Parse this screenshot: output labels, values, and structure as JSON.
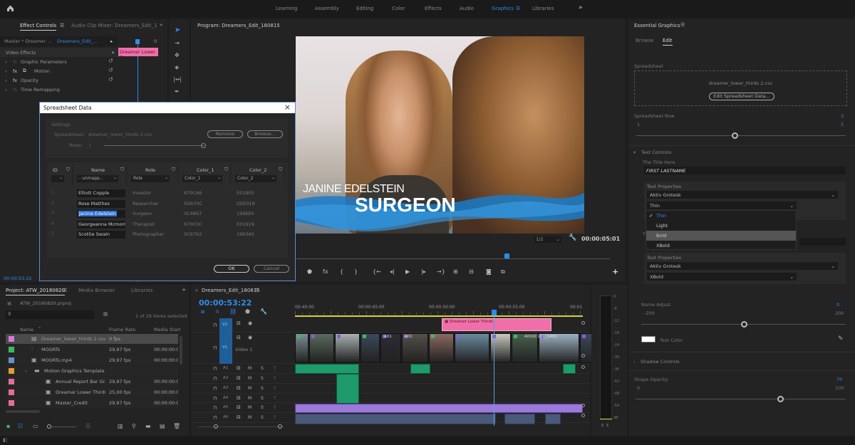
{
  "topbar": {
    "home_icon": "home-icon",
    "workspaces": [
      "Learning",
      "Assembly",
      "Editing",
      "Color",
      "Effects",
      "Audio",
      "Graphics",
      "Libraries"
    ],
    "active": "Graphics",
    "more": "»"
  },
  "effect_controls": {
    "tabs": [
      "Effect Controls",
      "Audio Clip Mixer: Dreamers_Edit_1"
    ],
    "master": "Master * Dreamer ...",
    "sequence": "Dreamers_Edit_...",
    "time_zero": "0",
    "clip_label": "Dreamer Lower T",
    "section": "Video Effects",
    "effects": [
      "Graphic Parameters",
      "Motion",
      "Opacity",
      "Time Remapping"
    ],
    "timecode": "00:00:53:22"
  },
  "dialog": {
    "title": "Spreadsheet Data",
    "close": "×",
    "settings_label": "Settings",
    "spreadsheet_label": "Spreadsheet:",
    "spreadsheet_file": "dreamer_lower_thirds 2.csv",
    "remove": "Remove",
    "browse": "Browse...",
    "rows_label": "Rows:",
    "rows_value": "1",
    "columns": [
      {
        "header": "ID",
        "mapping": ""
      },
      {
        "header": "Name",
        "mapping": "- unmapp..."
      },
      {
        "header": "Role",
        "mapping": "Role"
      },
      {
        "header": "Color_1",
        "mapping": "Color_1"
      },
      {
        "header": "Color_2",
        "mapping": "Color_2"
      }
    ],
    "rows": [
      {
        "id": "1",
        "name": "Elliott Copple",
        "role": "Investor",
        "c1": "670C66",
        "c2": "E019E0"
      },
      {
        "id": "2",
        "name": "Rose Matthes",
        "role": "Researcher",
        "c1": "5D670C",
        "c2": "DEE019"
      },
      {
        "id": "3",
        "name": "Janine Edelstein",
        "role": "Surgeon",
        "c1": "0C4867",
        "c2": "199EE0"
      },
      {
        "id": "4",
        "name": "Georgeanna Mcmorr",
        "role": "Therapist",
        "c1": "670C0C",
        "c2": "E01919"
      },
      {
        "id": "5",
        "name": "Scottie Swain",
        "role": "Photographer",
        "c1": "0C6762",
        "c2": "19E0A5"
      }
    ],
    "ok": "OK",
    "cancel": "Cancel"
  },
  "program": {
    "title": "Program: Dreamers_Edit_180815",
    "lower_third_name": "JANINE EDELSTEIN",
    "lower_third_role": "SURGEON",
    "resolution": "1/2",
    "timecode": "00:00:05:01",
    "controls": [
      "marker-icon",
      "fx-icon",
      "mark-in-icon",
      "mark-out-icon",
      "go-to-in-icon",
      "step-back-icon",
      "play-icon",
      "step-forward-icon",
      "go-to-out-icon",
      "insert-icon",
      "overwrite-icon",
      "camera-icon",
      "compare-icon"
    ],
    "add": "+"
  },
  "essential_graphics": {
    "title": "Essential Graphics",
    "tabs": [
      "Browse",
      "Edit"
    ],
    "active_tab": "Edit",
    "spreadsheet_label": "Spreadsheet",
    "spreadsheet_file": "dreamer_lower_thirds 2.csv",
    "edit_button": "Edit Spreadsheet Data...",
    "row_label": "Spreadsheet Row",
    "row_value": "3",
    "row_min": "1",
    "row_max": "5",
    "row_position": 0.5,
    "text_controls": "Text Controls",
    "title_label": "The Title Here",
    "title_value": "FIRST LASTNAME",
    "text_properties": "Text Properties",
    "font": "Aktiv Grotesk",
    "weight": "Thin",
    "weight_options": [
      "Thin",
      "Light",
      "Bold",
      "XBold"
    ],
    "weight_checked": "Thin",
    "weight_hover": "Bold",
    "text_properties_2": "Text Properties",
    "font_2": "Aktiv Grotesk",
    "weight_2": "XBold",
    "name_adjust_label": "Name Adjust",
    "name_adjust_value": "0",
    "name_adjust_min": "-200",
    "name_adjust_max": "200",
    "name_adjust_position": 0.5,
    "text_color_label": "Text Color",
    "text_color": "#ffffff",
    "shadow_controls": "Shadow Controls",
    "shape_opacity_label": "Shape Opacity",
    "shape_opacity_value": "70",
    "shape_opacity_min": "0",
    "shape_opacity_max": "100"
  },
  "project": {
    "tabs": [
      "Project: ATW_20180820",
      "Media Browser",
      "Libraries"
    ],
    "file": "ATW_20180820.prproj",
    "count": "1 of 29 items selected",
    "columns": [
      "Name",
      "Frame Rate",
      "Media Start"
    ],
    "items": [
      {
        "name": "Dreamer_lower_thirds 2.csv",
        "rate": "0 fps",
        "start": "",
        "color": "#d67ad6",
        "icon": "csv-icon",
        "indent": 1,
        "selected": true
      },
      {
        "name": "MOGRTs",
        "rate": "29,97 fps",
        "start": "00:00:00:0",
        "color": "#3fb860",
        "icon": "sequence-icon",
        "indent": 1
      },
      {
        "name": "MOGRTs.mp4",
        "rate": "29,97 fps",
        "start": "00:00:00:0",
        "color": "#6a8fd0",
        "icon": "video-icon",
        "indent": 1
      },
      {
        "name": "Motion Graphics Template",
        "rate": "",
        "start": "",
        "color": "#e0a030",
        "icon": "folder-icon",
        "indent": 0,
        "folder": true
      },
      {
        "name": "Annual Report Bar Gra",
        "rate": "29,97 fps",
        "start": "00:00:00:0",
        "color": "#e86a9a",
        "icon": "mogrt-icon",
        "indent": 2
      },
      {
        "name": "Dreamer Lower Thirds",
        "rate": "25,00 fps",
        "start": "00:00:00:0",
        "color": "#e86a9a",
        "icon": "mogrt-icon",
        "indent": 2
      },
      {
        "name": "Master_Credit",
        "rate": "29,97 fps",
        "start": "00:00:00:0",
        "color": "#e86a9a",
        "icon": "mogrt-icon",
        "indent": 2
      }
    ]
  },
  "timeline": {
    "title": "Dreamers_Edit_180815",
    "timecode": "00:00:53:22",
    "ruler": [
      "00:40:00",
      "00:00:45:00",
      "00:00:50:00",
      "00:00:55:00",
      "00:01"
    ],
    "tracks": [
      {
        "id": "V2",
        "type": "video"
      },
      {
        "id": "V1",
        "type": "video",
        "name": "Video 1"
      },
      {
        "id": "A1",
        "type": "audio"
      },
      {
        "id": "A2",
        "type": "audio"
      },
      {
        "id": "A3",
        "type": "audio"
      },
      {
        "id": "A4",
        "type": "audio"
      },
      {
        "id": "A5",
        "type": "audio"
      },
      {
        "id": "A6",
        "type": "audio"
      }
    ],
    "graphic_clip": "Dreamer Lower Thirds",
    "video_clip_labels": [
      "A01",
      "A01",
      "A010C131_1405"
    ],
    "mute": "M",
    "solo": "S"
  },
  "meter": {
    "scale": [
      "0",
      "-6",
      "-12",
      "-18",
      "-24",
      "-30",
      "-36",
      "-42",
      "-48",
      "-54",
      "dB"
    ],
    "solo": [
      "S",
      "S"
    ]
  }
}
